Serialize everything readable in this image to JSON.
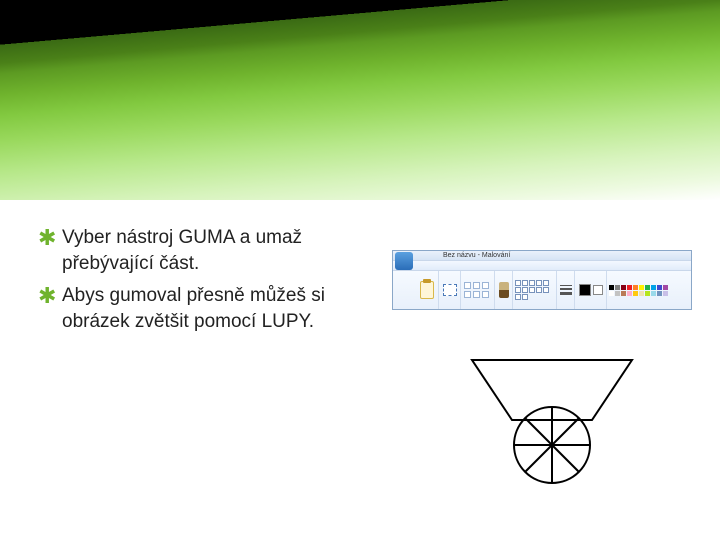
{
  "bullets": [
    "Vyber nástroj GUMA a umaž přebývající část.",
    "Abys gumoval přesně můžeš si obrázek zvětšit pomocí LUPY."
  ],
  "bullet_glyph": "✱",
  "paint": {
    "title": "Bez názvu - Malování"
  },
  "palette": [
    "#000000",
    "#7f7f7f",
    "#880015",
    "#ed1c24",
    "#ff7f27",
    "#fff200",
    "#22b14c",
    "#00a2e8",
    "#3f48cc",
    "#a349a4",
    "#ffffff",
    "#c3c3c3",
    "#b97a57",
    "#ffaec9",
    "#ffc90e",
    "#efe4b0",
    "#b5e61d",
    "#99d9ea",
    "#7092be",
    "#c8bfe7"
  ]
}
